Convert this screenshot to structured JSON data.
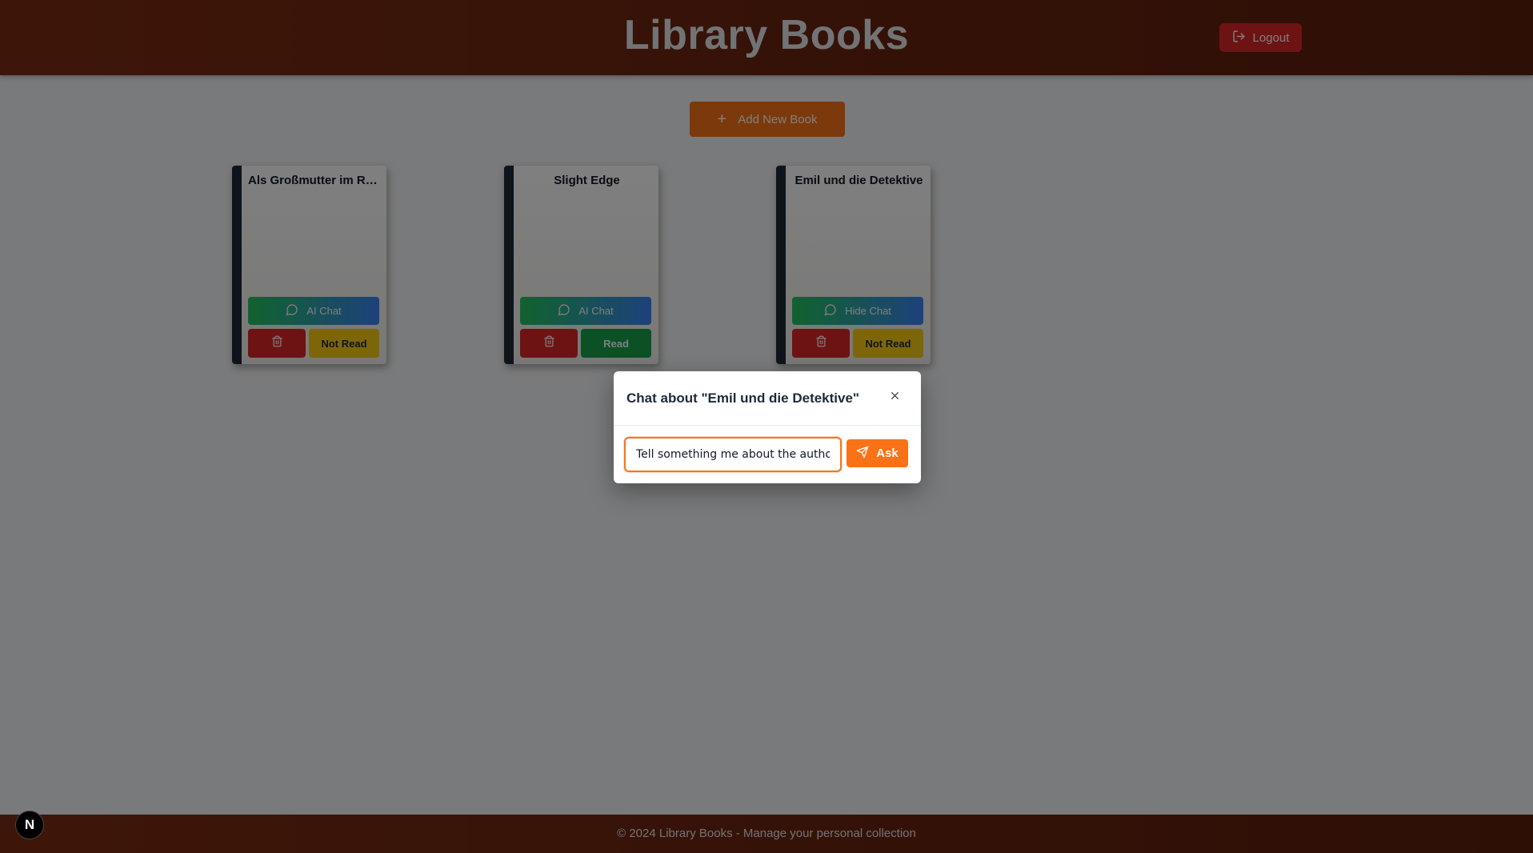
{
  "header": {
    "title": "Library Books",
    "logout_label": "Logout"
  },
  "actions": {
    "add_book_label": "Add New Book"
  },
  "books": [
    {
      "title": "Als Großmutter im Re...",
      "chat_label": "AI Chat",
      "status_label": "Not Read"
    },
    {
      "title": "Slight Edge",
      "chat_label": "AI Chat",
      "status_label": "Read"
    },
    {
      "title": "Emil und die Detektive",
      "chat_label": "Hide Chat",
      "status_label": "Not Read"
    }
  ],
  "chat_modal": {
    "title": "Chat about \"Emil und die Detektive\"",
    "input_value": "Tell something me about the author's",
    "ask_label": "Ask"
  },
  "footer": {
    "text": "© 2024 Library Books - Manage your personal collection"
  },
  "dev_badge": {
    "label": "N"
  },
  "colors": {
    "header": "#7c2d12",
    "accent": "#f97316",
    "danger": "#dc2626",
    "read": "#16a34a",
    "not_read": "#facc15"
  },
  "icons": [
    "logout-icon",
    "plus-icon",
    "message-icon",
    "trash-icon",
    "close-icon",
    "send-icon"
  ]
}
